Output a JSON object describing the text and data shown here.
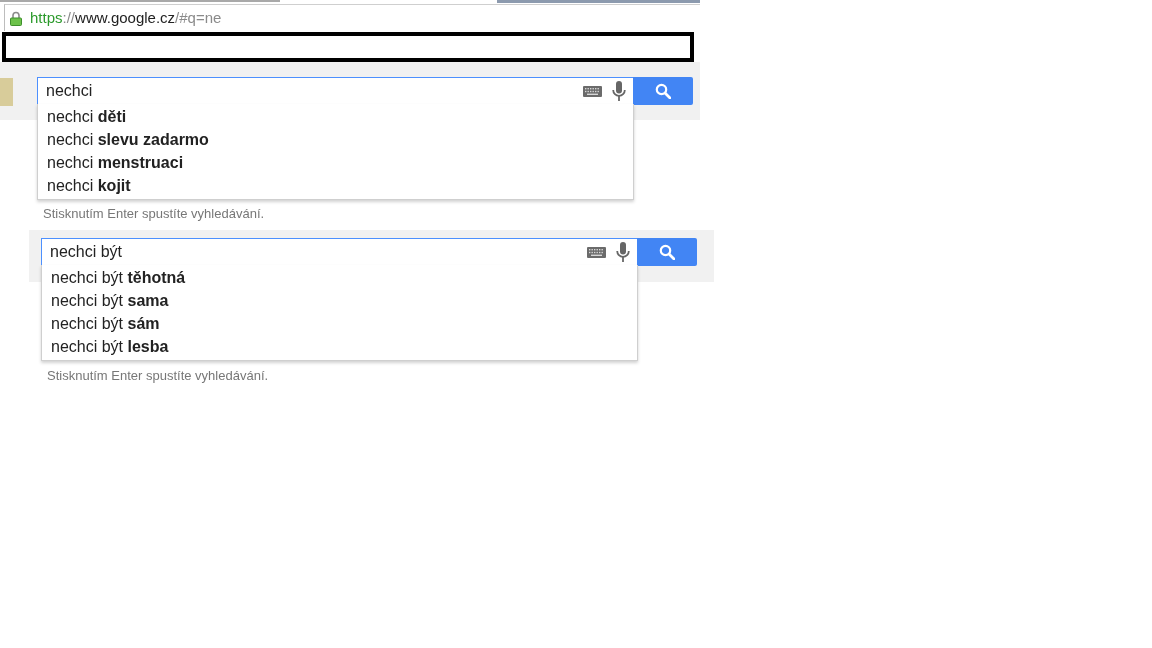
{
  "browser": {
    "url_parts": [
      {
        "text": "https",
        "kind": "scheme"
      },
      {
        "text": "://",
        "kind": "punct"
      },
      {
        "text": "www.google.cz",
        "kind": "host"
      },
      {
        "text": "/#q=ne",
        "kind": "rest"
      }
    ]
  },
  "searches": [
    {
      "thumbnail": true,
      "query": "nechci",
      "suggestions": [
        "nechci **děti**",
        "nechci **slevu zadarmo**",
        "nechci **menstruaci**",
        "nechci **kojit**"
      ],
      "hint": "Stisknutím Enter spustíte vyhledávání."
    },
    {
      "thumbnail": false,
      "query": "nechci být",
      "suggestions": [
        "nechci být **těhotná**",
        "nechci být **sama**",
        "nechci být **sám**",
        "nechci být **lesba**"
      ],
      "hint": "Stisknutím Enter spustíte vyhledávání."
    }
  ]
}
